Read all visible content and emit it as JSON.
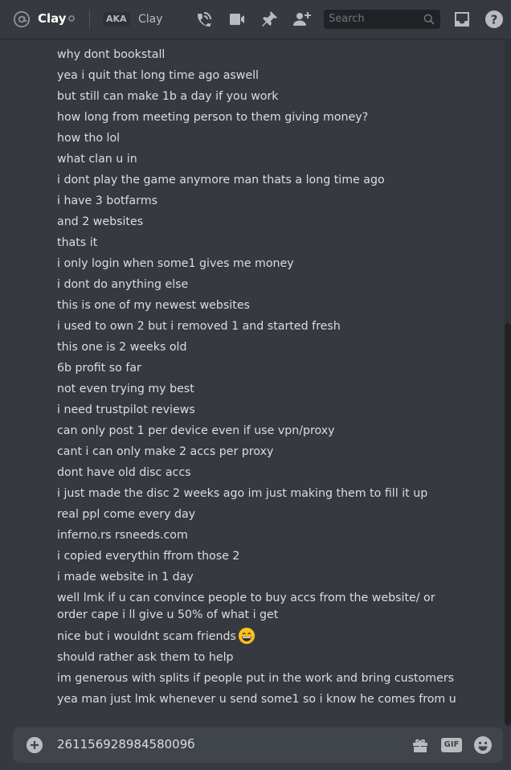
{
  "header": {
    "channel_name": "Clay",
    "aka_label": "AKA",
    "aka_name": "Clay",
    "search_placeholder": "Search",
    "icons": [
      "at-icon",
      "status-idle-icon",
      "call-icon",
      "video-icon",
      "pin-icon",
      "add-member-icon",
      "search-icon",
      "inbox-icon",
      "help-icon"
    ]
  },
  "messages": [
    "why dont bookstall",
    "yea i quit that long time ago aswell",
    "but still can make 1b a day if you work",
    "how long from meeting person to them giving money?",
    "how tho lol",
    "what clan u in",
    "i dont play the game anymore man thats a long time ago",
    "i have 3 botfarms",
    "and 2 websites",
    "thats it",
    "i only login when some1 gives me money",
    "i dont do anything else",
    "this is one of my newest websites",
    "i used to own 2 but i removed 1 and started fresh",
    "this one is 2 weeks old",
    "6b profit so far",
    "not even trying my best",
    "i need trustpilot reviews",
    "can only post 1 per device even if use vpn/proxy",
    "cant i can only make 2 accs per proxy",
    "dont have old disc accs",
    "i just made the disc 2 weeks ago im just making them to fill it up",
    "real ppl come every day",
    "inferno.rs rsneeds.com",
    "i copied everythin ffrom those 2",
    "i made website in 1 day",
    "well lmk if u can convince people to buy accs from the website/ or order cape i ll give u 50% of what i get",
    "nice but i wouldnt scam friends",
    "should rather ask them to help",
    "im generous with splits if people put in the work and bring customers",
    "yea man just lmk whenever u send some1 so i know he comes from u"
  ],
  "composer": {
    "text": "26115692898458009б",
    "gif_label": "GIF",
    "icons": [
      "add-attachment-icon",
      "gift-icon",
      "gif-icon",
      "emoji-icon"
    ]
  },
  "colors": {
    "background": "#36393f",
    "composer": "#40444b",
    "search": "#202225",
    "text": "#dcddde",
    "muted": "#b9bbbe"
  }
}
